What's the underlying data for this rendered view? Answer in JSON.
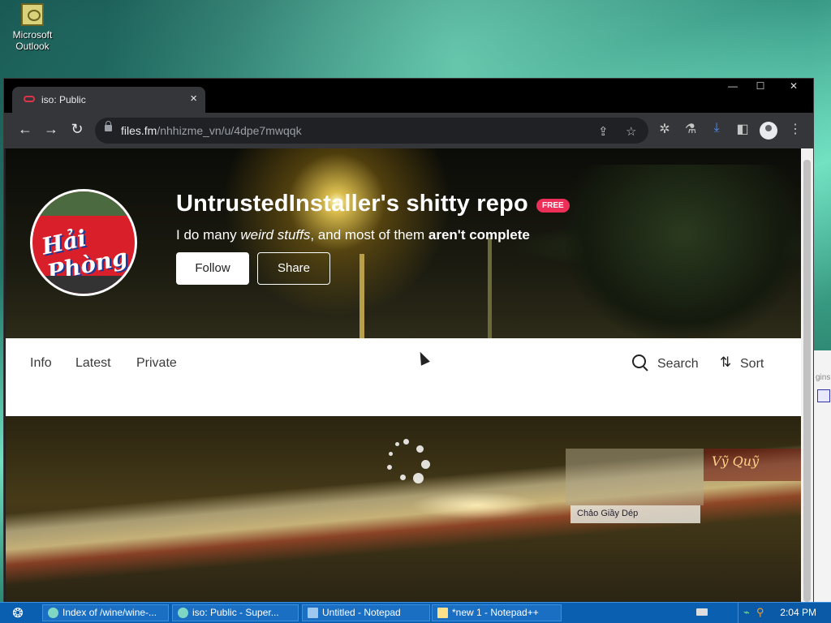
{
  "desktop": {
    "icon_label_line1": "Microsoft",
    "icon_label_line2": "Outlook",
    "bg_window_text": "gins"
  },
  "browser": {
    "tab_title": "iso: Public",
    "tab_close": "×",
    "url_host": "files.fm",
    "url_path": "/nhhizme_vn/u/4dpe7mwqqk",
    "win_minimize": "—",
    "win_maximize": "☐",
    "win_close": "✕"
  },
  "page": {
    "repo_title": "UntrustedInstaller's shitty repo",
    "badge": "FREE",
    "desc_part1": "I do many ",
    "desc_italic": "weird stuffs",
    "desc_part2": ", and most of them ",
    "desc_bold": "aren't complete",
    "follow_label": "Follow",
    "share_label": "Share",
    "profile_text": "Hải Phòng",
    "tabs": [
      {
        "label": "Info"
      },
      {
        "label": "Latest"
      },
      {
        "label": "Private"
      }
    ],
    "search_label": "Search",
    "sort_label": "Sort",
    "content_sign": "Vỹ Quỹ",
    "content_shop": "Chảo Giầy Dép"
  },
  "taskbar": {
    "tasks": [
      {
        "label": "Index of /wine/wine-..."
      },
      {
        "label": "iso: Public - Super..."
      },
      {
        "label": "Untitled - Notepad"
      },
      {
        "label": "*new 1 - Notepad++"
      }
    ],
    "clock": "2:04 PM"
  },
  "colors": {
    "accent_badge": "#ec2f59",
    "taskbar": "#0b5fb0",
    "download_icon": "#4c8df6"
  }
}
